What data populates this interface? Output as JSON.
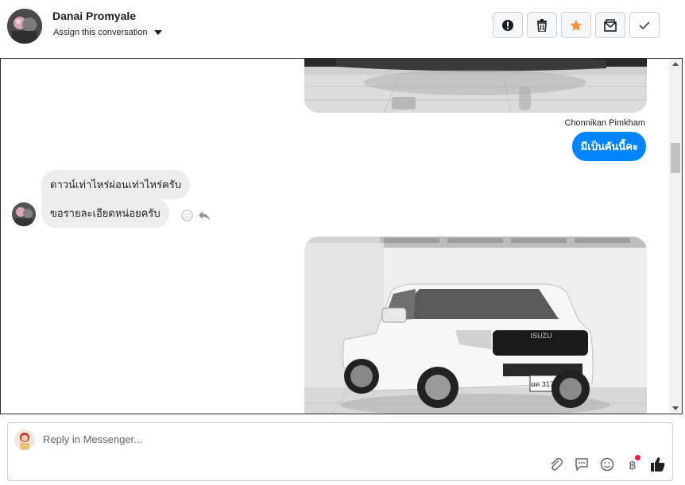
{
  "header": {
    "contact_name": "Danai Promyale",
    "assign_label": "Assign this conversation",
    "actions": [
      {
        "name": "spam-button",
        "icon": "alert-icon"
      },
      {
        "name": "delete-button",
        "icon": "trash-icon"
      },
      {
        "name": "star-button",
        "icon": "star-icon",
        "color": "#f7923b"
      },
      {
        "name": "mark-unread-button",
        "icon": "envelope-icon"
      },
      {
        "name": "mark-done-button",
        "icon": "check-icon"
      }
    ]
  },
  "thread": {
    "outgoing": {
      "sender": "Chonnikan Pimkham",
      "text": "มีเป็นคันนี้คะ"
    },
    "incoming": [
      {
        "text": "ดาวน์เท่าไหร่ผ่อนเท่าไหร่ครับ"
      },
      {
        "text": "ขอรายละเอียดหน่อยครับ"
      }
    ],
    "car_plate": "ผค 3176",
    "car_brand": "ISUZU"
  },
  "composer": {
    "placeholder": "Reply in Messenger...",
    "tools": [
      "paperclip-icon",
      "saved-reply-icon",
      "emoji-icon",
      "baht-icon",
      "thumbs-up-icon"
    ]
  },
  "colors": {
    "accent": "#0084ff",
    "incoming_bubble": "#ededed",
    "star": "#f7923b"
  }
}
